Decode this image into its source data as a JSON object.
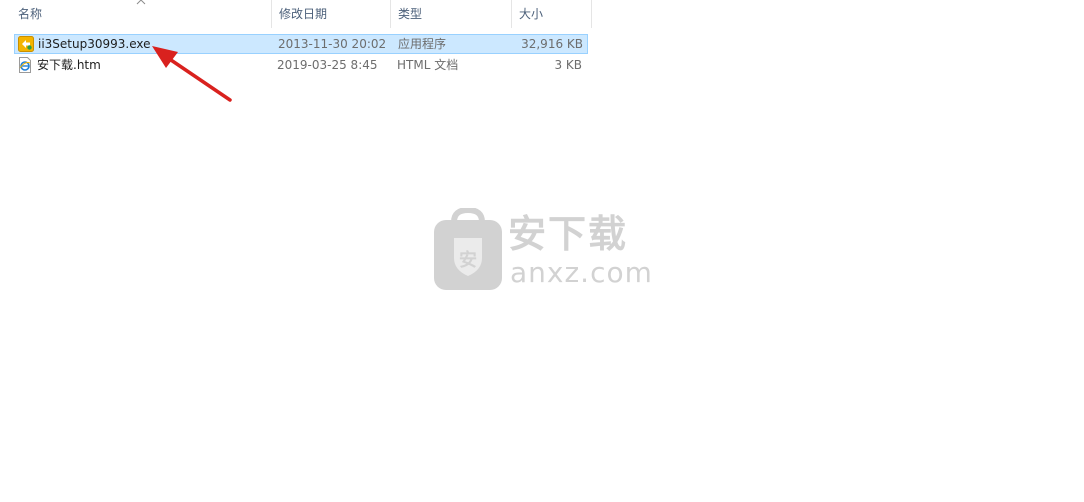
{
  "columns": {
    "name": "名称",
    "modified": "修改日期",
    "type": "类型",
    "size": "大小"
  },
  "files": [
    {
      "name": "ii3Setup30993.exe",
      "modified": "2013-11-30 20:02",
      "type": "应用程序",
      "size": "32,916 KB",
      "icon": "installer-icon",
      "selected": true
    },
    {
      "name": "安下载.htm",
      "modified": "2019-03-25 8:45",
      "type": "HTML 文档",
      "size": "3 KB",
      "icon": "ie-html-icon",
      "selected": false
    }
  ],
  "watermark": {
    "cn": "安下载",
    "en": "anxz.com",
    "badge": "安"
  },
  "colors": {
    "selection_bg": "#cce8ff",
    "selection_border": "#99d1ff",
    "header_text": "#4c607a",
    "arrow": "#d9211e",
    "watermark": "#d2d2d2"
  }
}
